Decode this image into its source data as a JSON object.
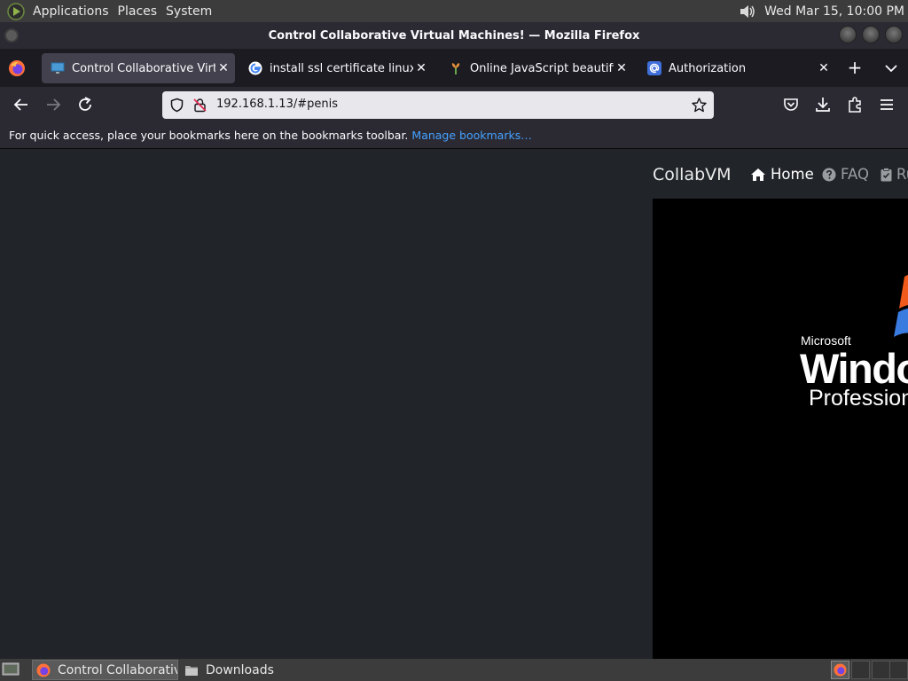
{
  "top_panel": {
    "menus": [
      "Applications",
      "Places",
      "System"
    ],
    "clock": "Wed Mar 15, 10:00 PM",
    "volume_icon": "speaker-icon"
  },
  "window": {
    "title": "Control Collaborative Virtual Machines! — Mozilla Firefox"
  },
  "tabs": [
    {
      "label": "Control Collaborative Virtual Machines!",
      "icon": "monitor-icon",
      "active": true
    },
    {
      "label": "install ssl certificate linux - Google Search",
      "icon": "google-icon",
      "active": false
    },
    {
      "label": "Online JavaScript beautifier",
      "icon": "beautifier-icon",
      "active": false
    },
    {
      "label": "Authorization",
      "icon": "at-sign-icon",
      "active": false
    }
  ],
  "navbar": {
    "url": "192.168.1.13/#penis"
  },
  "bookmarks_bar": {
    "message": "For quick access, place your bookmarks here on the bookmarks toolbar.",
    "link": "Manage bookmarks…"
  },
  "page": {
    "brand": "CollabVM",
    "nav_links": [
      {
        "label": "Home",
        "icon": "home-icon"
      },
      {
        "label": "FAQ",
        "icon": "question-circle-icon"
      },
      {
        "label": "Rules",
        "icon": "clipboard-check-icon"
      }
    ],
    "vm_screen": {
      "maker": "Microsoft",
      "product": "Windows",
      "edition": "Professional"
    }
  },
  "taskbar": {
    "tasks": [
      {
        "label": "Control Collaborative Virtual Machines! — Mozilla Firefox",
        "active": true
      },
      {
        "label": "Downloads",
        "active": false
      }
    ]
  },
  "colors": {
    "panel": "#3c3c3c",
    "firefox_chrome": "#2b2a33",
    "active_tab": "#42414d",
    "link": "#45a1ff",
    "page_bg": "#212529"
  }
}
